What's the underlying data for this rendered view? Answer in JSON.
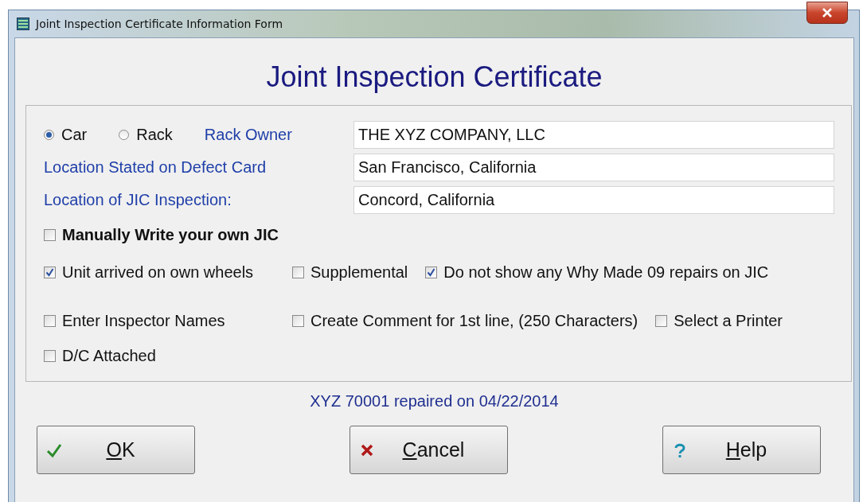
{
  "window": {
    "title": "Joint Inspection Certificate Information Form"
  },
  "heading": "Joint Inspection Certificate",
  "radios": [
    {
      "label": "Car",
      "selected": true
    },
    {
      "label": "Rack",
      "selected": false
    }
  ],
  "fields": [
    {
      "label": "Rack Owner",
      "value": "THE XYZ COMPANY, LLC"
    },
    {
      "label": "Location Stated on Defect Card",
      "value": "San Francisco, California"
    },
    {
      "label": "Location of JIC Inspection:",
      "value": "Concord, California"
    }
  ],
  "manual_jic": {
    "label": "Manually Write your own JIC",
    "checked": false
  },
  "option_rows": [
    [
      {
        "label": "Unit arrived on own wheels",
        "checked": true
      },
      {
        "label": "Supplemental",
        "checked": false
      },
      {
        "label": "Do not show any Why Made 09 repairs on JIC",
        "checked": true
      }
    ],
    [
      {
        "label": "Enter Inspector Names",
        "checked": false
      },
      {
        "label": "Create Comment for 1st line, (250 Characters)",
        "checked": false
      },
      {
        "label": "Select a Printer",
        "checked": false
      }
    ],
    [
      {
        "label": "D/C Attached",
        "checked": false
      }
    ]
  ],
  "status": "XYZ 70001 repaired on 04/22/2014",
  "buttons": [
    {
      "label": "OK",
      "kind": "ok"
    },
    {
      "label": "Cancel",
      "kind": "cancel"
    },
    {
      "label": "Help",
      "kind": "help"
    }
  ]
}
